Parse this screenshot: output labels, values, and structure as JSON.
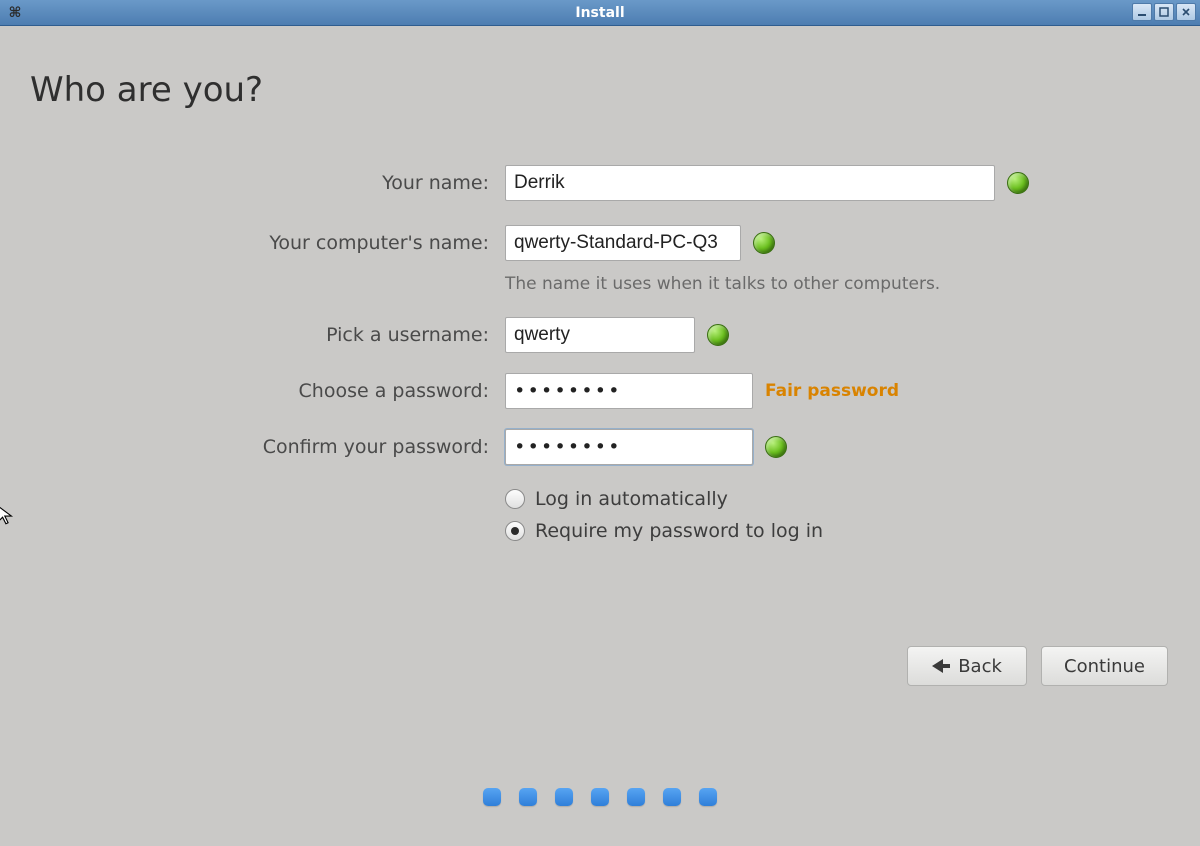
{
  "window": {
    "title": "Install",
    "app_icon_glyph": "⌘"
  },
  "page": {
    "heading": "Who are you?"
  },
  "form": {
    "name_label": "Your name:",
    "name_value": "Derrik",
    "computer_label": "Your computer's name:",
    "computer_value": "qwerty-Standard-PC-Q3",
    "computer_hint": "The name it uses when it talks to other computers.",
    "username_label": "Pick a username:",
    "username_value": "qwerty",
    "password_label": "Choose a password:",
    "password_value": "••••••••",
    "password_strength": "Fair password",
    "confirm_label": "Confirm your password:",
    "confirm_value": "••••••••",
    "auto_login_label": "Log in automatically",
    "require_pw_label": "Require my password to log in"
  },
  "login_option_selected": "require_password",
  "footer": {
    "back": "Back",
    "continue": "Continue"
  },
  "progress": {
    "total_dots": 7
  }
}
